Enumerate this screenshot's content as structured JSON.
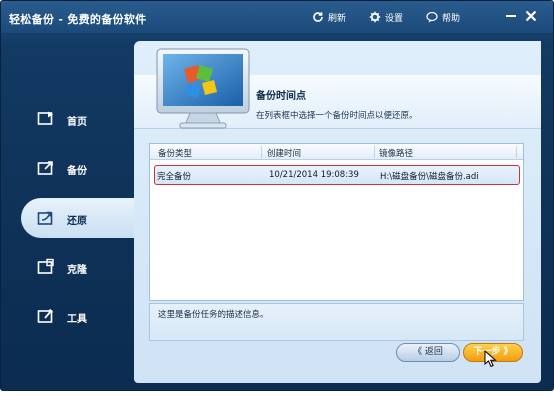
{
  "app": {
    "title": "轻松备份 - 免费的备份软件"
  },
  "toolbar": {
    "refresh": "刷新",
    "settings": "设置",
    "help": "帮助"
  },
  "sidebar": {
    "items": [
      {
        "label": "首页",
        "icon": "home-icon",
        "active": false
      },
      {
        "label": "备份",
        "icon": "backup-icon",
        "active": false
      },
      {
        "label": "还原",
        "icon": "restore-icon",
        "active": true
      },
      {
        "label": "克隆",
        "icon": "clone-icon",
        "active": false
      },
      {
        "label": "工具",
        "icon": "tools-icon",
        "active": false
      }
    ]
  },
  "step": {
    "title": "备份时间点",
    "description": "在列表框中选择一个备份时间点以便还原。"
  },
  "table": {
    "columns": [
      "备份类型",
      "创建时间",
      "镜像路径"
    ],
    "rows": [
      {
        "type": "完全备份",
        "time": "10/21/2014 19:08:39",
        "path": "H:\\磁盘备份\\磁盘备份.adi",
        "selected": true
      }
    ]
  },
  "description_box": {
    "text": "这里是备份任务的描述信息。"
  },
  "buttons": {
    "back": "《 返回",
    "next": "下一步 》"
  },
  "colors": {
    "accent": "#f29c0f",
    "selection_border": "#d0303a",
    "window_bg": "#0e3157"
  }
}
